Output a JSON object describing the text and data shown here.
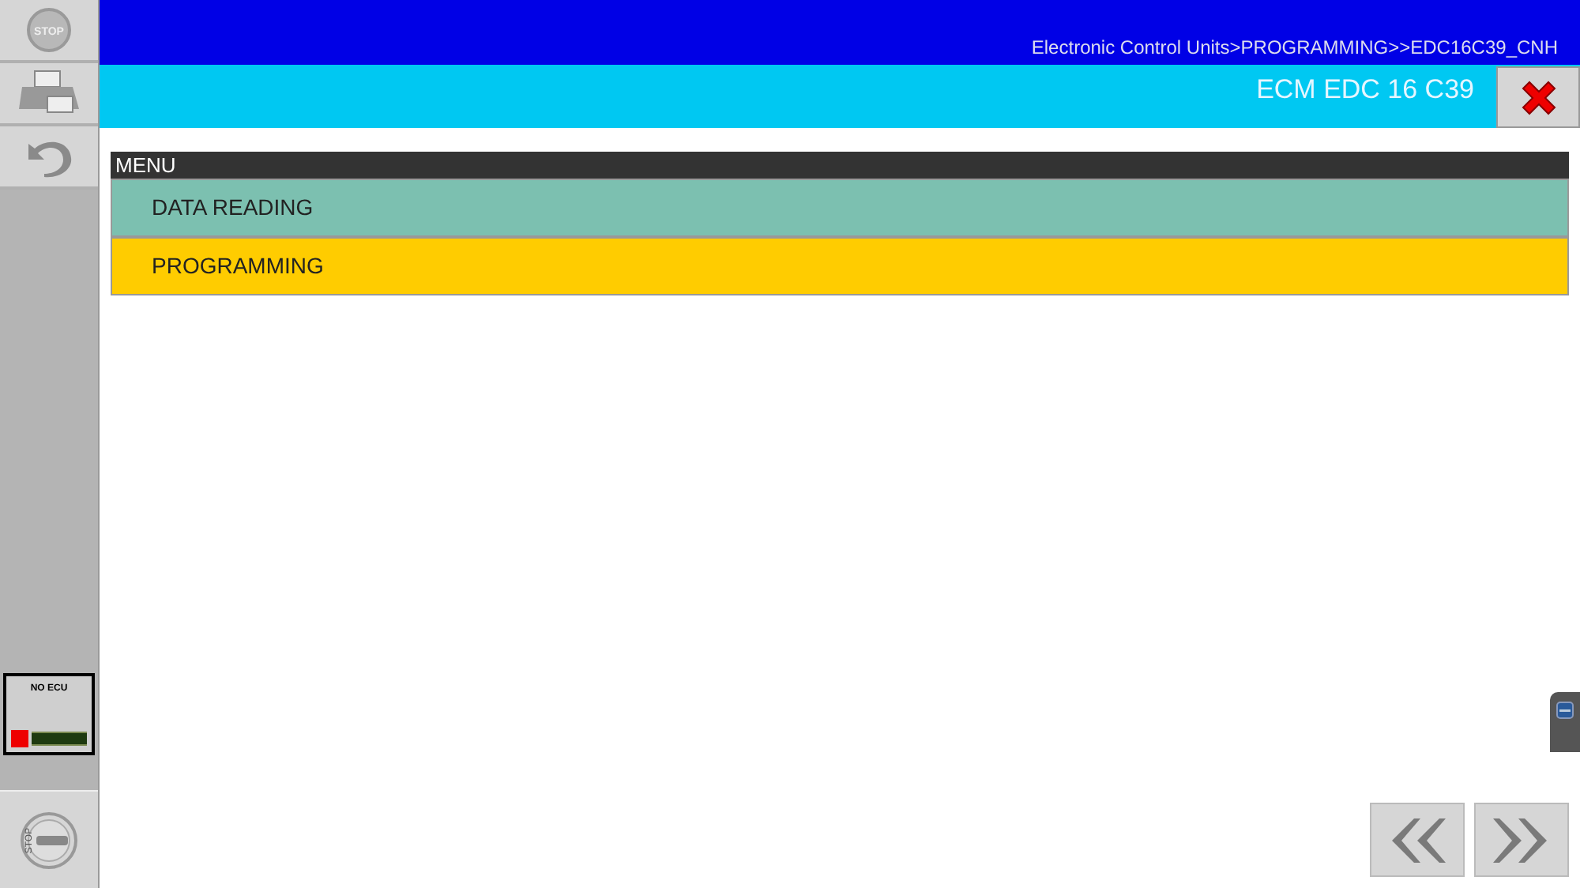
{
  "sidebar": {
    "stop_label": "STOP",
    "ecu_status": {
      "label": "NO ECU",
      "connected": false
    },
    "key_label": "STOP"
  },
  "header": {
    "breadcrumb": "Electronic Control Units>PROGRAMMING>>EDC16C39_CNH",
    "title": "ECM EDC 16 C39"
  },
  "menu": {
    "title": "MENU",
    "items": [
      {
        "label": "DATA READING",
        "selected": false
      },
      {
        "label": "PROGRAMMING",
        "selected": true
      }
    ]
  }
}
